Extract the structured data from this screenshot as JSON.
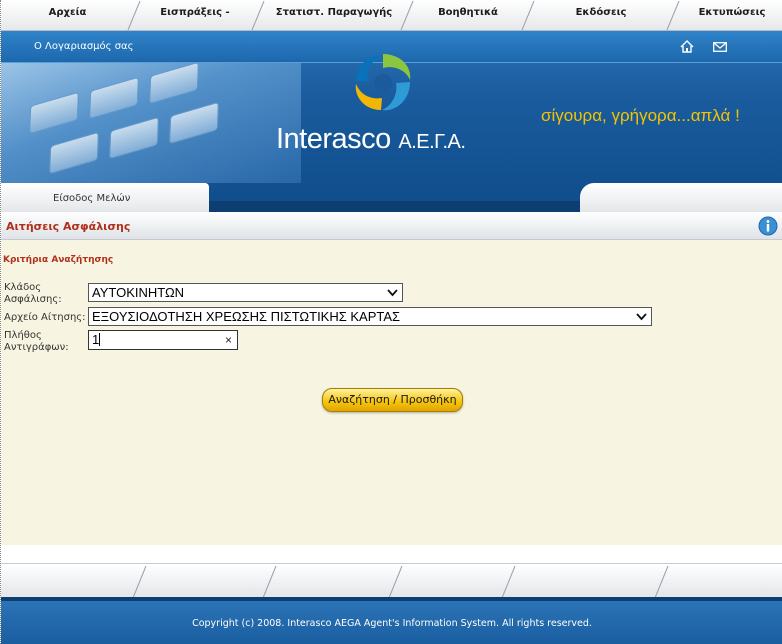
{
  "topnav": {
    "items": [
      {
        "label": "Αρχεία"
      },
      {
        "label": "Εισπράξεις - Πληρωμές"
      },
      {
        "label": "Στατιστ. Παραγωγής"
      },
      {
        "label": "Βοηθητικά"
      },
      {
        "label": "Εκδόσεις"
      },
      {
        "label": "Εκτυπώσεις"
      }
    ]
  },
  "banner": {
    "account_link": "Ο Λογαριασμός σας",
    "brand": "Interasco",
    "brand_suffix": "Α.Ε.Γ.Α.",
    "slogan": "σίγουρα, γρήγορα...απλά !",
    "member_tab": "Είσοδος Μελών"
  },
  "section": {
    "title": "Αιτήσεις Ασφάλισης"
  },
  "form": {
    "criteria_heading": "Κριτήρια Αναζήτησης",
    "branch_label_1": "Κλάδος",
    "branch_label_2": "Ασφάλισης:",
    "branch_value": "ΑΥΤΟΚΙΝΗΤΩΝ",
    "file_label": "Αρχείο Αίτησης:",
    "file_value": "ΕΞΟΥΣΙΟΔΟΤΗΣΗ ΧΡΕΩΣΗΣ ΠΙΣΤΩΤΙΚΗΣ ΚΑΡΤΑΣ",
    "copies_label_1": "Πλήθος",
    "copies_label_2": "Αντιγράφων:",
    "copies_value": "1",
    "clear_glyph": "×",
    "search_button": "Αναζήτηση / Προσθήκη"
  },
  "footer": {
    "copyright": "Copyright (c) 2008. Interasco AEGA Agent's Information System. All rights reserved."
  },
  "colors": {
    "accent_red": "#b0301c",
    "brand_blue": "#1a5ea0",
    "slogan_yellow": "#f5c400",
    "content_bg": "#f7f5e1"
  },
  "icons": [
    "home-icon",
    "mail-icon",
    "info-icon",
    "chevron-down-icon",
    "logo-swirl"
  ]
}
